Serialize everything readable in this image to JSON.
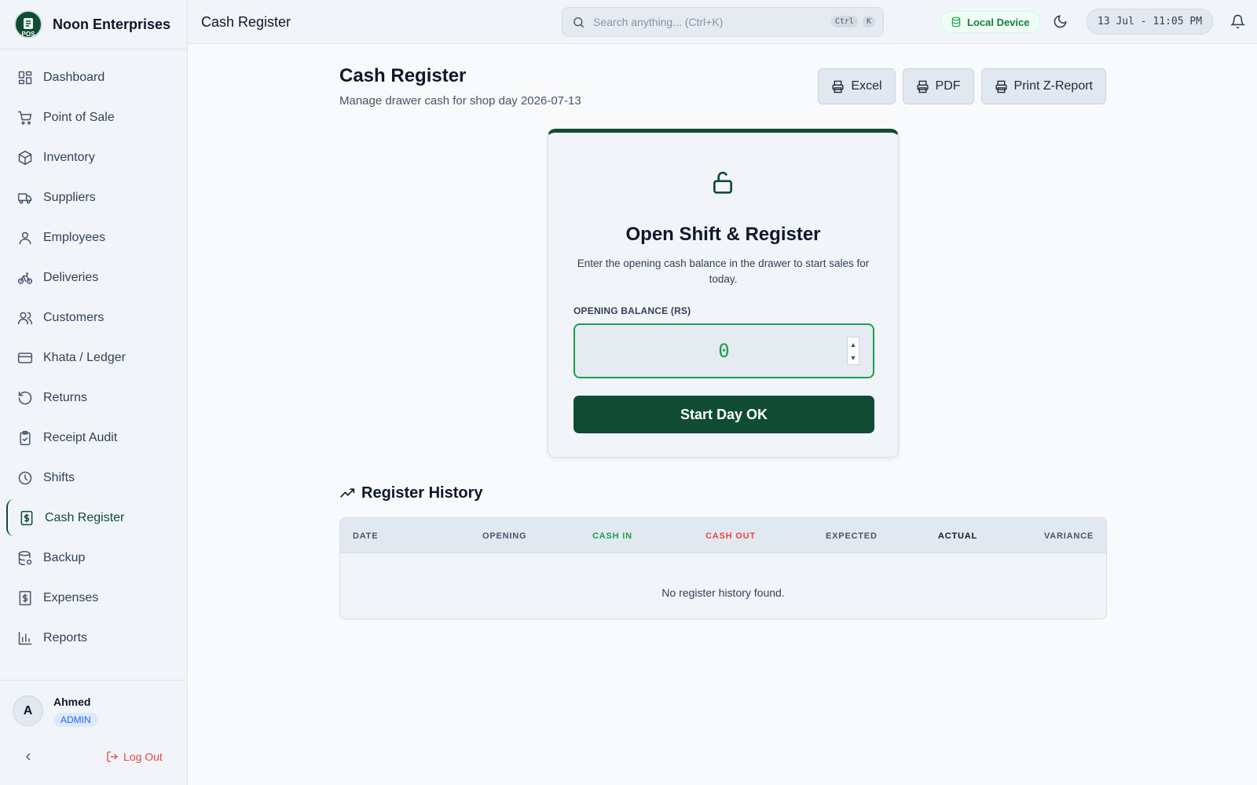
{
  "brand": {
    "name": "Noon Enterprises",
    "logo_text": "POS"
  },
  "sidebar": {
    "items": [
      {
        "label": "Dashboard",
        "icon": "dashboard-icon"
      },
      {
        "label": "Point of Sale",
        "icon": "cart-icon"
      },
      {
        "label": "Inventory",
        "icon": "box-icon"
      },
      {
        "label": "Suppliers",
        "icon": "truck-icon"
      },
      {
        "label": "Employees",
        "icon": "user-icon"
      },
      {
        "label": "Deliveries",
        "icon": "bike-icon"
      },
      {
        "label": "Customers",
        "icon": "users-icon"
      },
      {
        "label": "Khata / Ledger",
        "icon": "card-icon"
      },
      {
        "label": "Returns",
        "icon": "rotate-icon"
      },
      {
        "label": "Receipt Audit",
        "icon": "clipboard-check-icon"
      },
      {
        "label": "Shifts",
        "icon": "clock-icon"
      },
      {
        "label": "Cash Register",
        "icon": "dollar-file-icon",
        "active": true
      },
      {
        "label": "Backup",
        "icon": "database-icon"
      },
      {
        "label": "Expenses",
        "icon": "receipt-icon"
      },
      {
        "label": "Reports",
        "icon": "bar-chart-icon"
      }
    ],
    "user": {
      "initial": "A",
      "name": "Ahmed",
      "role": "ADMIN"
    },
    "logout_label": "Log Out"
  },
  "header": {
    "title": "Cash Register",
    "search_placeholder": "Search anything... (Ctrl+K)",
    "kbd_ctrl": "Ctrl",
    "kbd_k": "K",
    "local_device": "Local Device",
    "datetime": "13 Jul - 11:05 PM"
  },
  "main": {
    "title": "Cash Register",
    "subtitle": "Manage drawer cash for shop day 2026-07-13",
    "buttons": {
      "excel": "Excel",
      "pdf": "PDF",
      "zreport": "Print Z-Report"
    }
  },
  "card": {
    "title": "Open Shift & Register",
    "description": "Enter the opening cash balance in the drawer to start sales for today.",
    "field_label": "OPENING BALANCE (RS)",
    "field_value": "0",
    "start_button": "Start Day OK"
  },
  "history": {
    "title": "Register History",
    "columns": [
      "DATE",
      "OPENING",
      "CASH IN",
      "CASH OUT",
      "EXPECTED",
      "ACTUAL",
      "VARIANCE"
    ],
    "empty_message": "No register history found."
  },
  "colors": {
    "brand_green": "#0f4c33",
    "success_green": "#16a34a",
    "danger_red": "#ef4444",
    "admin_blue": "#2563eb"
  }
}
